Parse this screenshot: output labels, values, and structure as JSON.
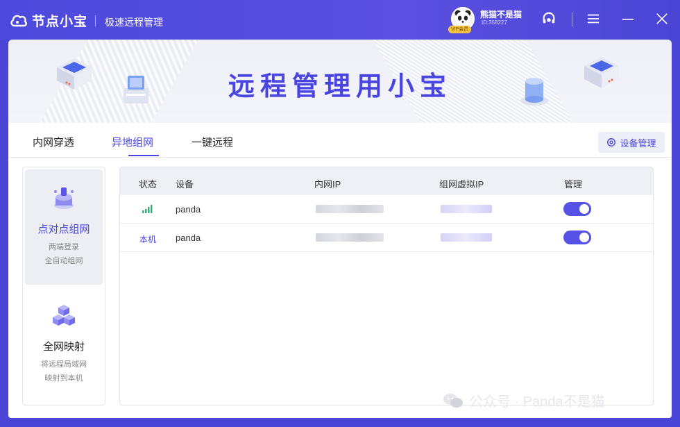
{
  "titlebar": {
    "brand": "节点小宝",
    "subtitle": "极速远程管理",
    "username": "熊猫不是猫",
    "user_id": "ID:358227",
    "vip_label": "VIP会员"
  },
  "banner": {
    "title": "远程管理用小宝"
  },
  "tabs": [
    {
      "label": "内网穿透"
    },
    {
      "label": "异地组网"
    },
    {
      "label": "一键远程"
    }
  ],
  "active_tab": "异地组网",
  "device_button": {
    "label": "设备管理"
  },
  "modes": [
    {
      "title": "点对点组网",
      "desc1": "两端登录",
      "desc2": "全自动组网",
      "active": true
    },
    {
      "title": "全网映射",
      "desc1": "将远程局域网",
      "desc2": "映射到本机",
      "active": false
    }
  ],
  "table": {
    "headers": {
      "status": "状态",
      "device": "设备",
      "lan_ip": "内网IP",
      "virtual_ip": "组网虚拟IP",
      "manage": "管理"
    },
    "rows": [
      {
        "status": "signal-icon",
        "device": "panda",
        "managed": true
      },
      {
        "status": "本机",
        "device": "panda",
        "managed": true
      }
    ]
  },
  "watermark": {
    "text": "公众号 · Panda不是猫"
  },
  "colors": {
    "accent": "#4a45e0",
    "titlebar": "#4c49dc"
  }
}
